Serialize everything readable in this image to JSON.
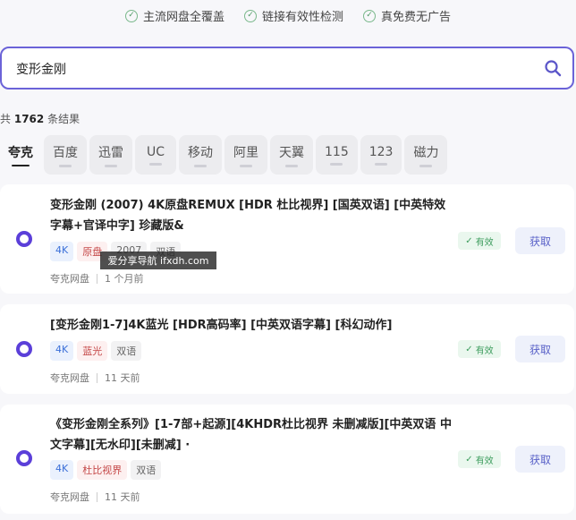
{
  "features": [
    "主流网盘全覆盖",
    "链接有效性检测",
    "真免费无广告"
  ],
  "search": {
    "value": "变形金刚"
  },
  "results_count": {
    "prefix": "共",
    "number": "1762",
    "suffix": "条结果"
  },
  "tabs": [
    "夸克",
    "百度",
    "迅雷",
    "UC",
    "移动",
    "阿里",
    "天翼",
    "115",
    "123",
    "磁力"
  ],
  "active_tab": "夸克",
  "results": [
    {
      "title": "变形金刚 (2007) 4K原盘REMUX [HDR 杜比视界] [国英双语] [中英特效字幕+官译中字] 珍藏版&",
      "tags": [
        {
          "text": "4K",
          "style": "blue"
        },
        {
          "text": "原盘",
          "style": "red"
        },
        {
          "text": "2007",
          "style": "gray"
        },
        {
          "text": "双语",
          "style": "gray"
        }
      ],
      "source": "夸克网盘",
      "time": "1 个月前",
      "status": "有效",
      "action": "获取"
    },
    {
      "title": "[变形金刚1-7]4K蓝光 [HDR高码率] [中英双语字幕] [科幻动作]",
      "tags": [
        {
          "text": "4K",
          "style": "blue"
        },
        {
          "text": "蓝光",
          "style": "red"
        },
        {
          "text": "双语",
          "style": "gray"
        }
      ],
      "source": "夸克网盘",
      "time": "11 天前",
      "status": "有效",
      "action": "获取"
    },
    {
      "title": "《变形金刚全系列》[1-7部+起源][4KHDR杜比视界 未删减版][中英双语 中文字幕][无水印][未删减] ·",
      "tags": [
        {
          "text": "4K",
          "style": "blue"
        },
        {
          "text": "杜比视界",
          "style": "red"
        },
        {
          "text": "双语",
          "style": "gray"
        }
      ],
      "source": "夸克网盘",
      "time": "11 天前",
      "status": "有效",
      "action": "获取"
    }
  ],
  "watermark": "爱分享导航 ifxdh.com",
  "colors": {
    "accent": "#5b3fd9",
    "search_border": "#6b63d8",
    "valid_green": "#3e9d5e",
    "get_button": "#5a62c8"
  }
}
